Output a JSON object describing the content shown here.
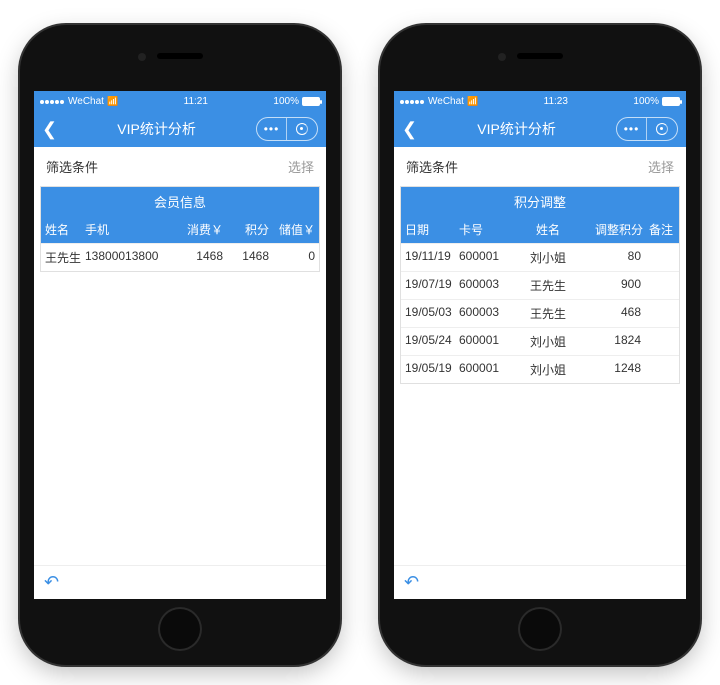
{
  "phones": [
    {
      "status": {
        "carrier": "WeChat",
        "time": "11:21",
        "battery": "100%"
      },
      "nav": {
        "title": "VIP统计分析"
      },
      "filter": {
        "label": "筛选条件",
        "action": "选择"
      },
      "table": {
        "title": "会员信息",
        "headers": [
          "姓名",
          "手机",
          "消费￥",
          "积分",
          "储值￥"
        ],
        "rows": [
          {
            "c1": "王先生",
            "c2": "13800013800",
            "c3": "1468",
            "c4": "1468",
            "c5": "0"
          }
        ]
      }
    },
    {
      "status": {
        "carrier": "WeChat",
        "time": "11:23",
        "battery": "100%"
      },
      "nav": {
        "title": "VIP统计分析"
      },
      "filter": {
        "label": "筛选条件",
        "action": "选择"
      },
      "table": {
        "title": "积分调整",
        "headers": [
          "日期",
          "卡号",
          "姓名",
          "调整积分",
          "备注"
        ],
        "rows": [
          {
            "c1": "19/11/19",
            "c2": "600001",
            "c3": "刘小姐",
            "c4": "80",
            "c5": ""
          },
          {
            "c1": "19/07/19",
            "c2": "600003",
            "c3": "王先生",
            "c4": "900",
            "c5": ""
          },
          {
            "c1": "19/05/03",
            "c2": "600003",
            "c3": "王先生",
            "c4": "468",
            "c5": ""
          },
          {
            "c1": "19/05/24",
            "c2": "600001",
            "c3": "刘小姐",
            "c4": "1824",
            "c5": ""
          },
          {
            "c1": "19/05/19",
            "c2": "600001",
            "c3": "刘小姐",
            "c4": "1248",
            "c5": ""
          }
        ]
      }
    }
  ]
}
